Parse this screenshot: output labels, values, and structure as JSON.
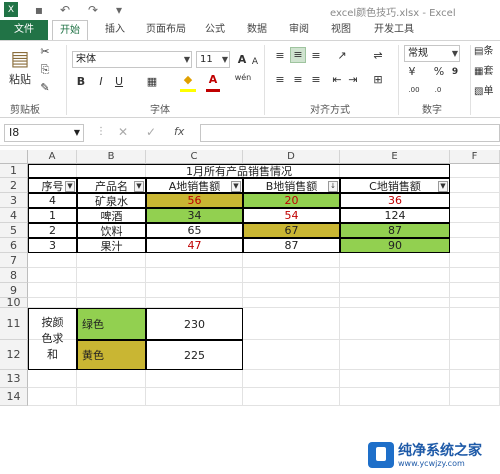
{
  "window": {
    "title": "excel颜色技巧.xlsx - Excel"
  },
  "tabs": [
    "文件",
    "开始",
    "插入",
    "页面布局",
    "公式",
    "数据",
    "审阅",
    "视图",
    "开发工具"
  ],
  "ribbon": {
    "clipboard": {
      "paste_label": "粘贴",
      "group_label": "剪贴板"
    },
    "font": {
      "name": "宋体",
      "size": "11",
      "group_label": "字体",
      "bold": "B",
      "italic": "I",
      "underline": "U",
      "grow": "A",
      "shrink": "A",
      "wen": "wén"
    },
    "alignment": {
      "group_label": "对齐方式"
    },
    "number": {
      "format": "常规",
      "percent": "%",
      "comma": "9",
      "group_label": "数字"
    },
    "styles_partial": [
      "条",
      "套",
      "单"
    ]
  },
  "formula_bar": {
    "name_box": "I8",
    "fx_label": "fx",
    "formula": ""
  },
  "sheet": {
    "columns": [
      "A",
      "B",
      "C",
      "D",
      "E",
      "F"
    ],
    "rows": [
      "1",
      "2",
      "3",
      "4",
      "5",
      "6",
      "7",
      "8",
      "9",
      "10",
      "11",
      "12",
      "13",
      "14"
    ],
    "title": "1月所有产品销售情况",
    "headers": [
      "序号",
      "产品名",
      "A地销售额",
      "B地销售额",
      "C地销售额"
    ],
    "data": [
      [
        "4",
        "矿泉水",
        "56",
        "20",
        "36"
      ],
      [
        "1",
        "啤酒",
        "34",
        "54",
        "124"
      ],
      [
        "2",
        "饮料",
        "65",
        "67",
        "87"
      ],
      [
        "3",
        "果汁",
        "47",
        "87",
        "90"
      ]
    ],
    "summary": {
      "label": "按颜色求和",
      "rows": [
        {
          "color": "绿色",
          "value": "230"
        },
        {
          "color": "黄色",
          "value": "225"
        }
      ]
    },
    "fill_colors": {
      "green": "#92d050",
      "olive": "#c9b633",
      "red_text": "#c00000"
    }
  },
  "watermark": {
    "name": "纯净系统之家",
    "url": "www.ycwjzy.com"
  }
}
